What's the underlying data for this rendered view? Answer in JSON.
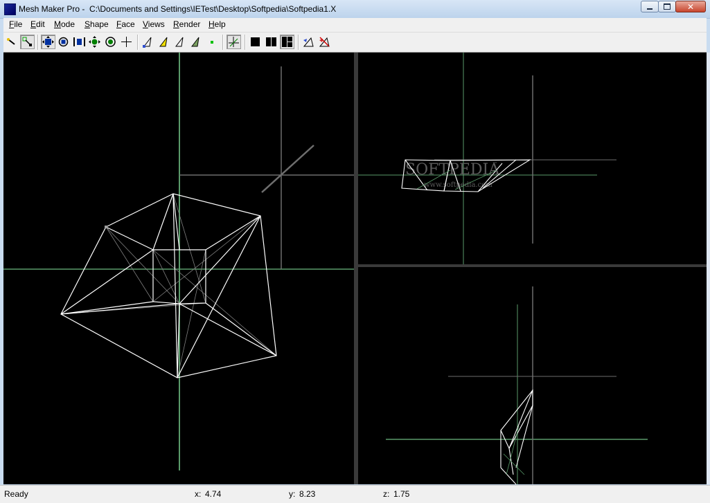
{
  "window": {
    "app_name": "Mesh Maker Pro -",
    "file_path": "C:\\Documents and Settings\\IETest\\Desktop\\Softpedia\\Softpedia1.X",
    "close_glyph": "✕"
  },
  "menu": [
    {
      "label": "File",
      "underline": "F",
      "rest": "ile"
    },
    {
      "label": "Edit",
      "underline": "E",
      "rest": "dit"
    },
    {
      "label": "Mode",
      "underline": "M",
      "rest": "ode"
    },
    {
      "label": "Shape",
      "underline": "S",
      "rest": "hape"
    },
    {
      "label": "Face",
      "underline": "F",
      "rest": "ace"
    },
    {
      "label": "Views",
      "underline": "V",
      "rest": "iews"
    },
    {
      "label": "Render",
      "underline": "R",
      "rest": "ender"
    },
    {
      "label": "Help",
      "underline": "H",
      "rest": "elp"
    }
  ],
  "toolbar": {
    "tools": [
      "select-tool-icon",
      "select-box-icon",
      "move-icon",
      "rotate-icon",
      "scale-icon",
      "translate-icon",
      "orbit-icon",
      "crosshair-icon",
      "vertex-add-icon",
      "vertex-yellow-icon",
      "vertex-outline-icon",
      "vertex-green-icon",
      "point-icon",
      "axis-icon",
      "view-single-icon",
      "view-double-icon",
      "view-quad-icon",
      "render-icon",
      "render-off-icon"
    ]
  },
  "viewports": {
    "watermark_text": "SOFTPEDIA",
    "watermark_sub": "www.softpedia.com",
    "watermark_tm": "™"
  },
  "status": {
    "text": "Ready",
    "x_label": "x:",
    "x_value": "4.74",
    "y_label": "y:",
    "y_value": "8.23",
    "z_label": "z:",
    "z_value": "1.75"
  },
  "colors": {
    "axis_green": "#5a9a6a",
    "grid_gray": "#6e6e6e",
    "wire": "#ffffff",
    "viewport_bg": "#000000"
  }
}
